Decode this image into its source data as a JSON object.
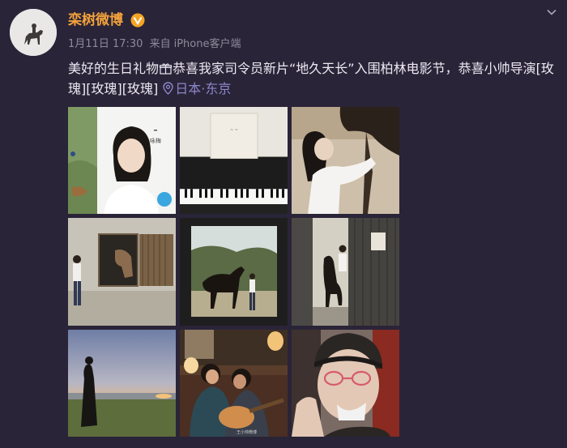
{
  "post": {
    "username": "栾树微博",
    "timestamp": "1月11日 17:30",
    "source_prefix": "来自",
    "source": "iPhone客户端",
    "text_part1": "美好的生日礼物",
    "text_part2": "恭喜我家司令员新片“地久天长”入围柏林电影节，恭喜小帅导演",
    "emoji": [
      "[玫瑰]",
      "[玫瑰]",
      "[玫瑰]"
    ],
    "location": "日本·东京",
    "photo_captions": {
      "poster_name": "咏梅",
      "watermark": "王小帅微博"
    }
  },
  "icons": {
    "verified": "verified-badge-icon",
    "more": "chevron-down-icon",
    "gift": "gift-icon",
    "location": "location-pin-icon"
  },
  "colors": {
    "background": "#2a2438",
    "username": "#f3a23b",
    "meta": "#8e8a9b",
    "location": "#8b86c9"
  }
}
